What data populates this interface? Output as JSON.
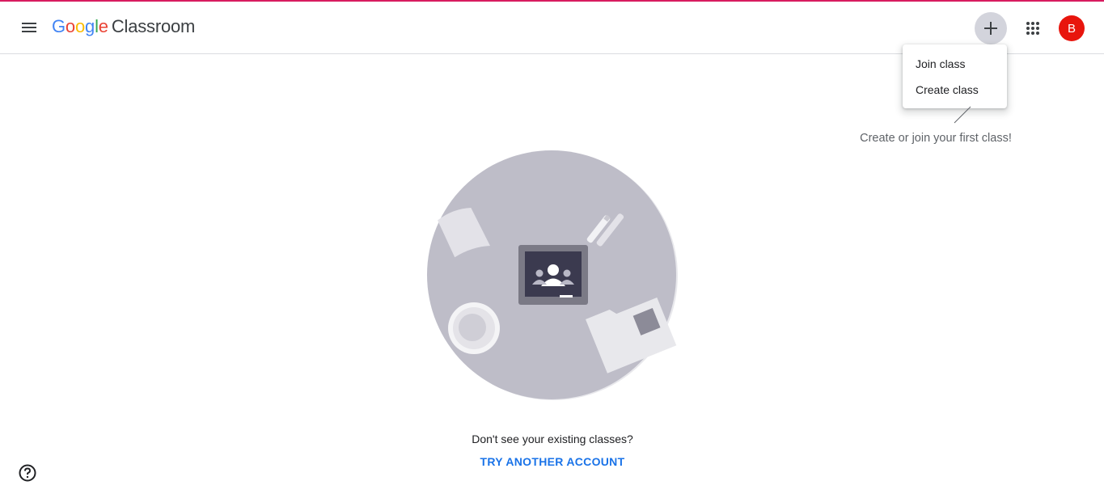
{
  "header": {
    "logo_letters": [
      "G",
      "o",
      "o",
      "g",
      "l",
      "e"
    ],
    "logo_colors": [
      "#4285f4",
      "#ea4335",
      "#fbbc04",
      "#4285f4",
      "#34a853",
      "#ea4335"
    ],
    "product_name": "Classroom",
    "menu_icon": "hamburger-menu-icon",
    "add_icon": "plus-icon",
    "apps_icon": "apps-grid-icon",
    "avatar_letter": "B",
    "avatar_color": "#e8150d"
  },
  "dropdown": {
    "items": [
      {
        "label": "Join class"
      },
      {
        "label": "Create class"
      }
    ]
  },
  "hint": {
    "text": "Create or join your first class!"
  },
  "empty_state": {
    "illustration_icon": "classroom-desk-illustration",
    "message": "Don't see your existing classes?",
    "link_label": "TRY ANOTHER ACCOUNT",
    "link_color": "#1a73e8"
  },
  "footer": {
    "help_icon": "help-circle-icon"
  }
}
